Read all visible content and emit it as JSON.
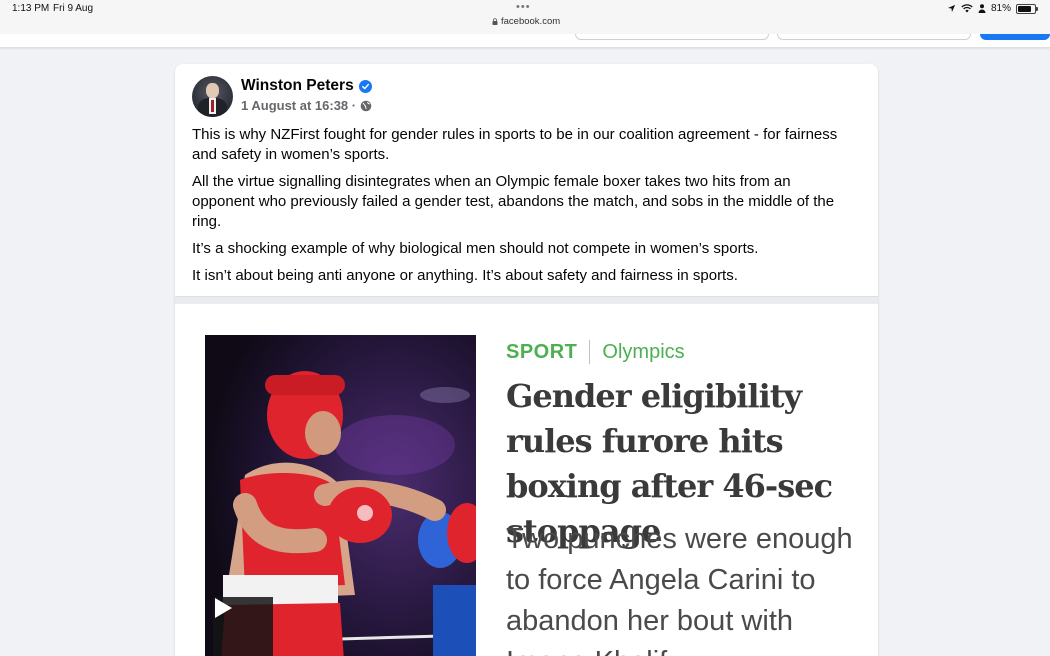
{
  "status_bar": {
    "time": "1:13 PM",
    "date": "Fri 9 Aug",
    "url": "facebook.com",
    "battery": "81%",
    "battery_level": 0.81
  },
  "post": {
    "author": "Winston Peters",
    "timestamp": "1 August at 16:38 ·",
    "paragraphs": [
      "This is why NZFirst fought for gender rules in sports to be in our coalition agreement - for fairness and safety in women’s sports.",
      "All the virtue signalling disintegrates when an Olympic female boxer takes two hits from an opponent who previously failed a gender test, abandons the match, and sobs in the middle of the ring.",
      "It’s a shocking example of why biological men should not compete in women’s sports.",
      "It isn’t about being anti anyone or anything. It’s about safety and fairness in sports."
    ]
  },
  "article": {
    "section": "SPORT",
    "subsection": "Olympics",
    "headline": "Gender eligibility rules furore hits boxing after 46-sec stoppage",
    "standfirst": "Two punches were enough to force Angela Carini to abandon her bout with Imane Khelif"
  },
  "colors": {
    "facebook_blue": "#1877f2",
    "section_green": "#4caf50",
    "page_bg": "#f0f2f5"
  },
  "icons": {
    "verified": "verified-badge-icon",
    "audience": "globe-icon",
    "play": "play-icon",
    "lock": "lock-icon"
  }
}
